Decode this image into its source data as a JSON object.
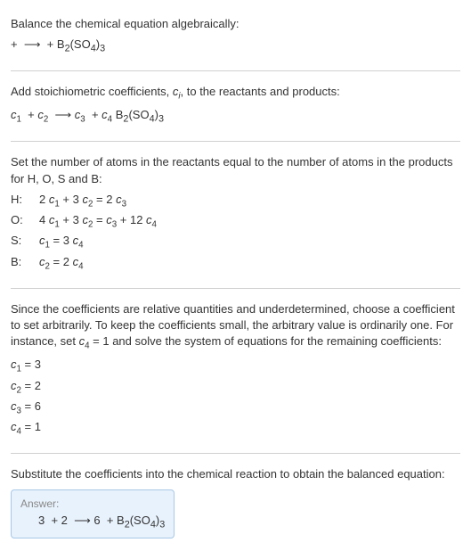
{
  "step1": {
    "title": "Balance the chemical equation algebraically:",
    "equation_html": " + &nbsp;⟶&nbsp; + B<sub>2</sub>(SO<sub>4</sub>)<sub>3</sub>"
  },
  "step2": {
    "title_html": "Add stoichiometric coefficients, <span class='ital'>c<sub class='sub'>i</sub></span>, to the reactants and products:",
    "equation_html": "<span class='ital'>c</span><sub class='subn'>1</sub>&nbsp; + <span class='ital'>c</span><sub class='subn'>2</sub>&nbsp; ⟶ <span class='ital'>c</span><sub class='subn'>3</sub>&nbsp; + <span class='ital'>c</span><sub class='subn'>4</sub> B<sub>2</sub>(SO<sub>4</sub>)<sub>3</sub>"
  },
  "step3": {
    "title": "Set the number of atoms in the reactants equal to the number of atoms in the products for H, O, S and B:",
    "rows": [
      {
        "label": "H:",
        "eq_html": "2 <span class='ital'>c</span><sub class='subn'>1</sub> + 3 <span class='ital'>c</span><sub class='subn'>2</sub> = 2 <span class='ital'>c</span><sub class='subn'>3</sub>"
      },
      {
        "label": "O:",
        "eq_html": "4 <span class='ital'>c</span><sub class='subn'>1</sub> + 3 <span class='ital'>c</span><sub class='subn'>2</sub> = <span class='ital'>c</span><sub class='subn'>3</sub> + 12 <span class='ital'>c</span><sub class='subn'>4</sub>"
      },
      {
        "label": "S:",
        "eq_html": "<span class='ital'>c</span><sub class='subn'>1</sub> = 3 <span class='ital'>c</span><sub class='subn'>4</sub>"
      },
      {
        "label": "B:",
        "eq_html": "<span class='ital'>c</span><sub class='subn'>2</sub> = 2 <span class='ital'>c</span><sub class='subn'>4</sub>"
      }
    ]
  },
  "step4": {
    "text_html": "Since the coefficients are relative quantities and underdetermined, choose a coefficient to set arbitrarily. To keep the coefficients small, the arbitrary value is ordinarily one. For instance, set <span class='ital'>c</span><sub class='subn'>4</sub> = 1 and solve the system of equations for the remaining coefficients:",
    "coeffs": [
      "<span class='ital'>c</span><sub class='subn'>1</sub> = 3",
      "<span class='ital'>c</span><sub class='subn'>2</sub> = 2",
      "<span class='ital'>c</span><sub class='subn'>3</sub> = 6",
      "<span class='ital'>c</span><sub class='subn'>4</sub> = 1"
    ]
  },
  "step5": {
    "title": "Substitute the coefficients into the chemical reaction to obtain the balanced equation:",
    "answer_label": "Answer:",
    "answer_html": "3&nbsp; + 2&nbsp; ⟶ 6&nbsp; + B<sub>2</sub>(SO<sub>4</sub>)<sub>3</sub>"
  }
}
